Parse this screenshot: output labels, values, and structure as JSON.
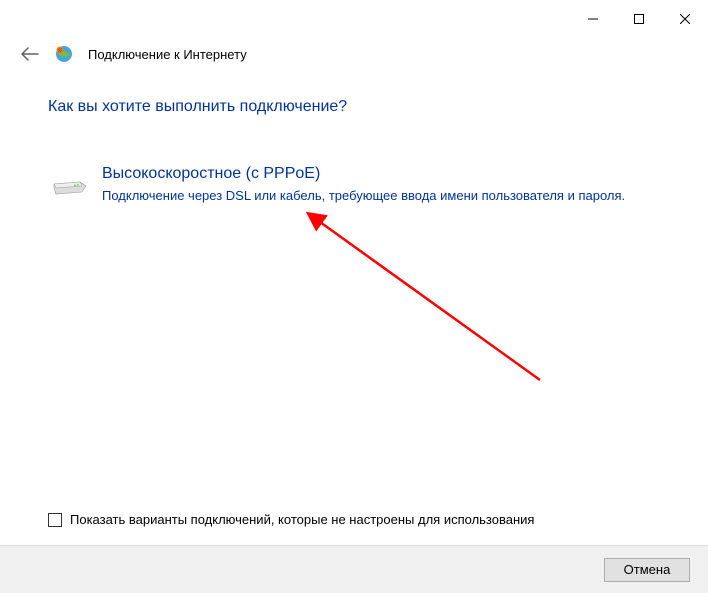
{
  "window": {
    "title": "Подключение к Интернету"
  },
  "heading": "Как вы хотите выполнить подключение?",
  "option": {
    "title": "Высокоскоростное (с PPPoE)",
    "description": "Подключение через DSL или кабель, требующее ввода имени пользователя и пароля."
  },
  "checkbox": {
    "label": "Показать варианты подключений, которые не настроены для использования",
    "checked": false
  },
  "buttons": {
    "cancel": "Отмена"
  }
}
